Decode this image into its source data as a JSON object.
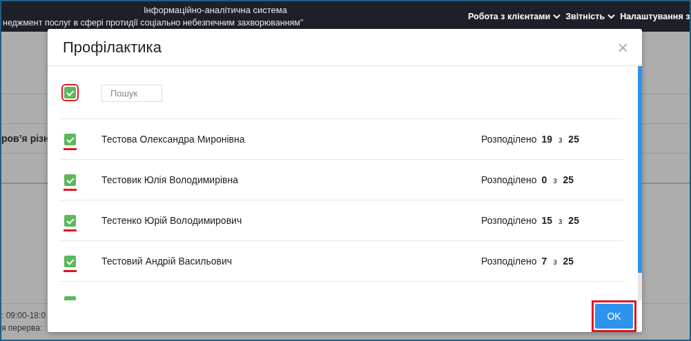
{
  "header": {
    "title_lines": [
      "Інформаційно-аналітична система",
      "неджмент послуг в сфері протидії соціально небезпечним захворюванням\""
    ],
    "nav": [
      {
        "label": "Робота з клієнтами",
        "dropdown": true
      },
      {
        "label": "Звітність",
        "dropdown": true
      },
      {
        "label": "Налаштування з",
        "dropdown": false
      }
    ]
  },
  "background": {
    "heading_fragment": "ров’я різн",
    "footer_lines": [
      ": 09:00-18:0",
      "я перерва:"
    ]
  },
  "dialog": {
    "title": "Профілактика",
    "close": "×",
    "select_all": {
      "checked": true,
      "highlighted": true
    },
    "search": {
      "placeholder": "Пошук"
    },
    "rows": [
      {
        "name": "Тестова Олександра Миронівна",
        "checked": true,
        "highlighted": true,
        "label": "Розподілено",
        "allocated": "19",
        "of": "з",
        "total": "25"
      },
      {
        "name": "Тестовик Юлія Володимирівна",
        "checked": true,
        "highlighted": true,
        "label": "Розподілено",
        "allocated": "0",
        "of": "з",
        "total": "25"
      },
      {
        "name": "Тестенко Юрій Володимирович",
        "checked": true,
        "highlighted": true,
        "label": "Розподілено",
        "allocated": "15",
        "of": "з",
        "total": "25"
      },
      {
        "name": "Тестовий Андрій Васильович",
        "checked": true,
        "highlighted": true,
        "label": "Розподілено",
        "allocated": "7",
        "of": "з",
        "total": "25"
      },
      {
        "checked": true,
        "highlighted": false
      }
    ],
    "ok_button": {
      "label": "OK",
      "highlighted": true
    }
  }
}
